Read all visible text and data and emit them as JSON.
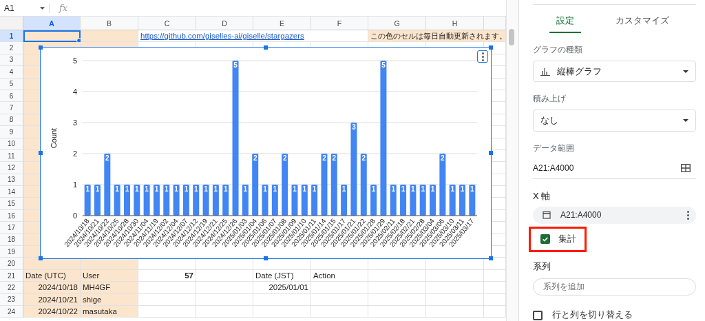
{
  "formula_bar": {
    "name_box": "A1",
    "function_label": "fx"
  },
  "columns": [
    {
      "label": "A",
      "selected": true,
      "auto_updated": true
    },
    {
      "label": "B",
      "selected": false,
      "auto_updated": true
    },
    {
      "label": "C",
      "selected": false,
      "auto_updated": false
    },
    {
      "label": "D",
      "selected": false,
      "auto_updated": false
    },
    {
      "label": "E",
      "selected": false,
      "auto_updated": false
    },
    {
      "label": "F",
      "selected": false,
      "auto_updated": false
    },
    {
      "label": "G",
      "selected": false,
      "auto_updated": false
    },
    {
      "label": "H",
      "selected": false,
      "auto_updated": false
    }
  ],
  "rows": [
    {
      "number": "1",
      "selected": true,
      "cells": [
        {
          "kind": "empty"
        },
        {
          "kind": "empty"
        },
        {
          "kind": "link",
          "text": "https://github.com/giselles-ai/giselle/stargazers"
        },
        {
          "kind": "empty"
        },
        {
          "kind": "empty"
        },
        {
          "kind": "empty"
        },
        {
          "kind": "note",
          "text": "この色のセルは毎日自動更新されます。"
        },
        {
          "kind": "empty"
        }
      ]
    },
    {
      "number": "2",
      "selected": false
    },
    {
      "number": "3",
      "selected": false
    },
    {
      "number": "4",
      "selected": false
    },
    {
      "number": "5",
      "selected": false
    },
    {
      "number": "6",
      "selected": false
    },
    {
      "number": "7",
      "selected": false
    },
    {
      "number": "8",
      "selected": false
    },
    {
      "number": "9",
      "selected": false
    },
    {
      "number": "10",
      "selected": false
    },
    {
      "number": "11",
      "selected": false
    },
    {
      "number": "12",
      "selected": false
    },
    {
      "number": "13",
      "selected": false
    },
    {
      "number": "14",
      "selected": false
    },
    {
      "number": "15",
      "selected": false
    },
    {
      "number": "16",
      "selected": false
    },
    {
      "number": "17",
      "selected": false
    },
    {
      "number": "18",
      "selected": false
    },
    {
      "number": "19",
      "selected": false
    },
    {
      "number": "20",
      "selected": false
    },
    {
      "number": "21",
      "selected": false,
      "cells": [
        {
          "kind": "text",
          "text": "Date (UTC)"
        },
        {
          "kind": "text",
          "text": "User"
        },
        {
          "kind": "total",
          "text": "57"
        },
        {
          "kind": "empty"
        },
        {
          "kind": "text",
          "text": "Date (JST)"
        },
        {
          "kind": "text",
          "text": "Action"
        },
        {
          "kind": "empty"
        },
        {
          "kind": "empty"
        }
      ]
    },
    {
      "number": "22",
      "selected": false,
      "cells": [
        {
          "kind": "number",
          "text": "2024/10/18"
        },
        {
          "kind": "text",
          "text": "MH4GF"
        },
        {
          "kind": "empty"
        },
        {
          "kind": "empty"
        },
        {
          "kind": "number",
          "text": "2025/01/01"
        },
        {
          "kind": "empty"
        },
        {
          "kind": "empty"
        },
        {
          "kind": "empty"
        }
      ]
    },
    {
      "number": "23",
      "selected": false,
      "cells": [
        {
          "kind": "number",
          "text": "2024/10/21"
        },
        {
          "kind": "text",
          "text": "shige"
        },
        {
          "kind": "empty"
        },
        {
          "kind": "empty"
        },
        {
          "kind": "empty"
        },
        {
          "kind": "empty"
        },
        {
          "kind": "empty"
        },
        {
          "kind": "empty"
        }
      ]
    },
    {
      "number": "24",
      "selected": false,
      "cells": [
        {
          "kind": "number",
          "text": "2024/10/22"
        },
        {
          "kind": "text",
          "text": "masutaka"
        },
        {
          "kind": "empty"
        },
        {
          "kind": "empty"
        },
        {
          "kind": "empty"
        },
        {
          "kind": "empty"
        },
        {
          "kind": "empty"
        },
        {
          "kind": "empty"
        }
      ]
    }
  ],
  "chart": {
    "chart_data": {
      "type": "bar",
      "ylabel": "Count",
      "yticks": [
        0,
        1,
        2,
        3,
        4,
        5
      ],
      "ylim": [
        0,
        5
      ],
      "grid": true,
      "data_labels": true,
      "categories": [
        "2024/10/18",
        "2024/10/21",
        "2024/10/22",
        "2024/10/25",
        "2024/10/28",
        "2024/10/30",
        "2024/11/04",
        "2024/11/19",
        "2024/12/02",
        "2024/12/04",
        "2024/12/07",
        "2024/12/12",
        "2024/12/19",
        "2024/12/21",
        "2024/12/25",
        "2024/12/26",
        "2025/01/03",
        "2025/01/04",
        "2025/01/06",
        "2025/01/07",
        "2025/01/08",
        "2025/01/09",
        "2025/01/10",
        "2025/01/11",
        "2025/01/14",
        "2025/01/15",
        "2025/01/17",
        "2025/01/21",
        "2025/01/22",
        "2025/01/28",
        "2025/01/29",
        "2025/02/11",
        "2025/02/18",
        "2025/02/21",
        "2025/02/28",
        "2025/03/04",
        "2025/03/06",
        "2025/03/10",
        "2025/03/11",
        "2025/03/17"
      ],
      "series": [
        {
          "color": "#4285f4",
          "values": [
            1,
            1,
            2,
            1,
            1,
            1,
            1,
            1,
            1,
            1,
            1,
            1,
            1,
            1,
            1,
            5,
            1,
            2,
            1,
            1,
            2,
            1,
            1,
            1,
            2,
            2,
            1,
            3,
            2,
            1,
            5,
            1,
            1,
            1,
            1,
            1,
            2,
            1,
            1,
            1
          ]
        }
      ]
    }
  },
  "panel": {
    "tabs": [
      {
        "label": "設定",
        "selected": true
      },
      {
        "label": "カスタマイズ",
        "selected": false
      }
    ],
    "chart_type": {
      "label": "グラフの種類",
      "value": "縦棒グラフ"
    },
    "stacking": {
      "label": "積み上げ",
      "value": "なし"
    },
    "data_range": {
      "label": "データ範囲",
      "value": "A21:A4000"
    },
    "x_axis": {
      "label": "X 軸",
      "range": "A21:A4000",
      "aggregate": {
        "label": "集計",
        "checked": true,
        "highlighted": true
      }
    },
    "series": {
      "label": "系列",
      "placeholder": "系列を追加"
    },
    "switch_rows_columns": {
      "label": "行と列を切り替える",
      "checked": false
    }
  }
}
